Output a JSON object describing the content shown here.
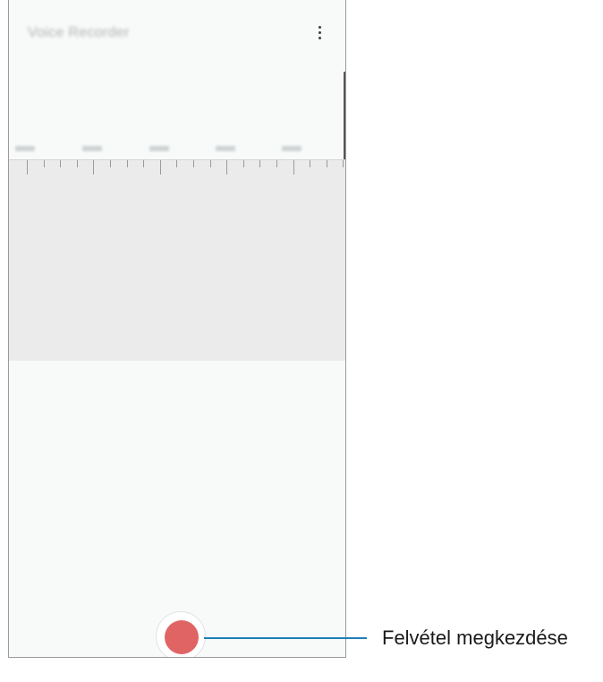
{
  "app": {
    "title": "Voice Recorder",
    "menu_icon": "more-vert-icon"
  },
  "controls": {
    "record_icon": "record-icon"
  },
  "callout": {
    "text": "Felvétel megkezdése"
  },
  "colors": {
    "record": "#e06464",
    "callout_line": "#1d7fb7",
    "ruler_bg": "#ebebeb",
    "screen_bg": "#f8f9f9"
  }
}
